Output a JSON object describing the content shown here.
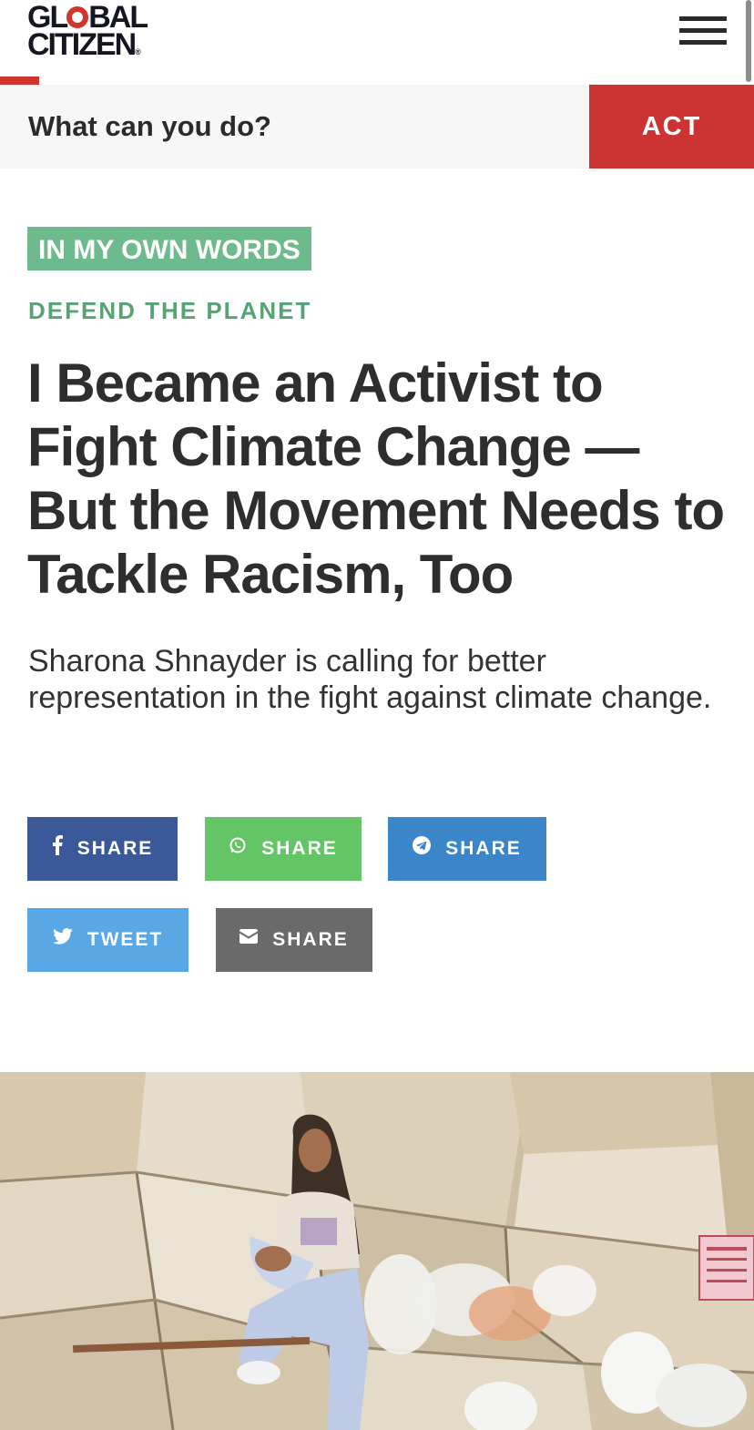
{
  "header": {
    "logo_line1_a": "GL",
    "logo_line1_b": "BAL",
    "logo_line2": "CITIZEN",
    "logo_reg": "®",
    "menu_icon": "hamburger-menu-icon"
  },
  "action_band": {
    "prompt": "What can you do?",
    "button_label": "ACT"
  },
  "article": {
    "series_tag": "IN MY OWN WORDS",
    "category": "DEFEND THE PLANET",
    "title": "I Became an Activist to Fight Climate Change — But the Movement Needs to Tackle Racism, Too",
    "subtitle": "Sharona Shnayder is calling for better representation in the fight against climate change."
  },
  "share_buttons": [
    {
      "label": "SHARE",
      "icon": "facebook-icon",
      "color": "#3b5998"
    },
    {
      "label": "SHARE",
      "icon": "whatsapp-icon",
      "color": "#63c565"
    },
    {
      "label": "SHARE",
      "icon": "telegram-icon",
      "color": "#3a86c8"
    },
    {
      "label": "TWEET",
      "icon": "twitter-icon",
      "color": "#5aa7e6"
    },
    {
      "label": "SHARE",
      "icon": "email-icon",
      "color": "#6a6a6a"
    }
  ],
  "colors": {
    "brand_red": "#cc3333",
    "tag_green": "#6dba8c",
    "category_green": "#55a473",
    "text_dark": "#2e2e2e"
  }
}
